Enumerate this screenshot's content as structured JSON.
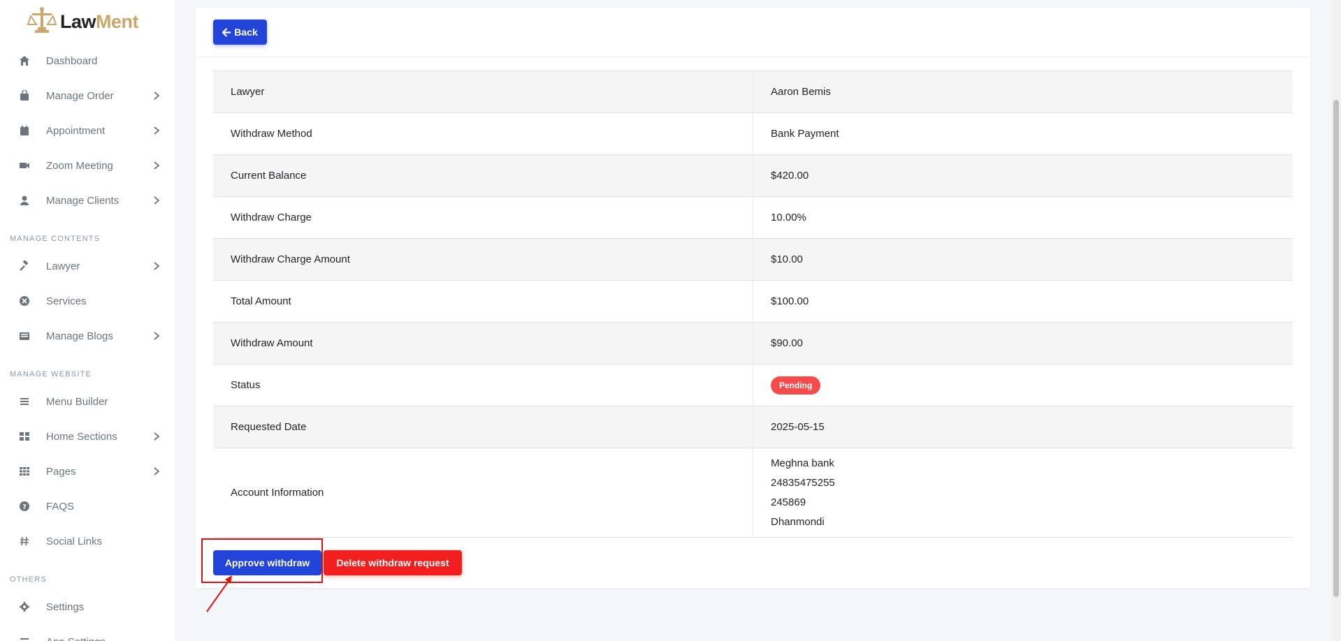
{
  "brand": {
    "part1": "Law",
    "part2": "Ment",
    "color1": "#222222",
    "color2": "#c9a86a"
  },
  "sidebar": {
    "items_main": [
      {
        "label": "Dashboard",
        "icon": "home-icon",
        "chevron": false
      },
      {
        "label": "Manage Order",
        "icon": "shopping-bag-icon",
        "chevron": true
      },
      {
        "label": "Appointment",
        "icon": "calendar-icon",
        "chevron": true
      },
      {
        "label": "Zoom Meeting",
        "icon": "video-icon",
        "chevron": true
      },
      {
        "label": "Manage Clients",
        "icon": "user-icon",
        "chevron": true
      }
    ],
    "header_contents": "MANAGE CONTENTS",
    "items_contents": [
      {
        "label": "Lawyer",
        "icon": "gavel-icon",
        "chevron": true
      },
      {
        "label": "Services",
        "icon": "circle-x-icon",
        "chevron": false
      },
      {
        "label": "Manage Blogs",
        "icon": "newspaper-icon",
        "chevron": true
      }
    ],
    "header_website": "MANAGE WEBSITE",
    "items_website": [
      {
        "label": "Menu Builder",
        "icon": "bars-icon",
        "chevron": false
      },
      {
        "label": "Home Sections",
        "icon": "grid-icon",
        "chevron": true
      },
      {
        "label": "Pages",
        "icon": "th-icon",
        "chevron": true
      },
      {
        "label": "FAQS",
        "icon": "question-circle-icon",
        "chevron": false
      },
      {
        "label": "Social Links",
        "icon": "hashtag-icon",
        "chevron": false
      }
    ],
    "header_others": "OTHERS",
    "items_others": [
      {
        "label": "Settings",
        "icon": "gear-icon",
        "chevron": false
      },
      {
        "label": "App Settings",
        "icon": "bars-icon",
        "chevron": false
      }
    ]
  },
  "back_label": "Back",
  "details": {
    "rows": [
      {
        "label": "Lawyer",
        "value": "Aaron Bemis"
      },
      {
        "label": "Withdraw Method",
        "value": "Bank Payment"
      },
      {
        "label": "Current Balance",
        "value": "$420.00"
      },
      {
        "label": "Withdraw Charge",
        "value": "10.00%"
      },
      {
        "label": "Withdraw Charge Amount",
        "value": "$10.00"
      },
      {
        "label": "Total Amount",
        "value": "$100.00"
      },
      {
        "label": "Withdraw Amount",
        "value": "$90.00"
      }
    ],
    "status_label": "Status",
    "status_value": "Pending",
    "date_label": "Requested Date",
    "date_value": "2025-05-15",
    "account_label": "Account Information",
    "account_lines": [
      "Meghna bank",
      "24835475255",
      "245869",
      "Dhanmondi"
    ]
  },
  "actions": {
    "approve": "Approve withdraw",
    "delete": "Delete withdraw request"
  },
  "colors": {
    "primary": "#2244d8",
    "danger": "#f31f1f",
    "badge": "#f54b4b",
    "annotation": "#e01010"
  }
}
